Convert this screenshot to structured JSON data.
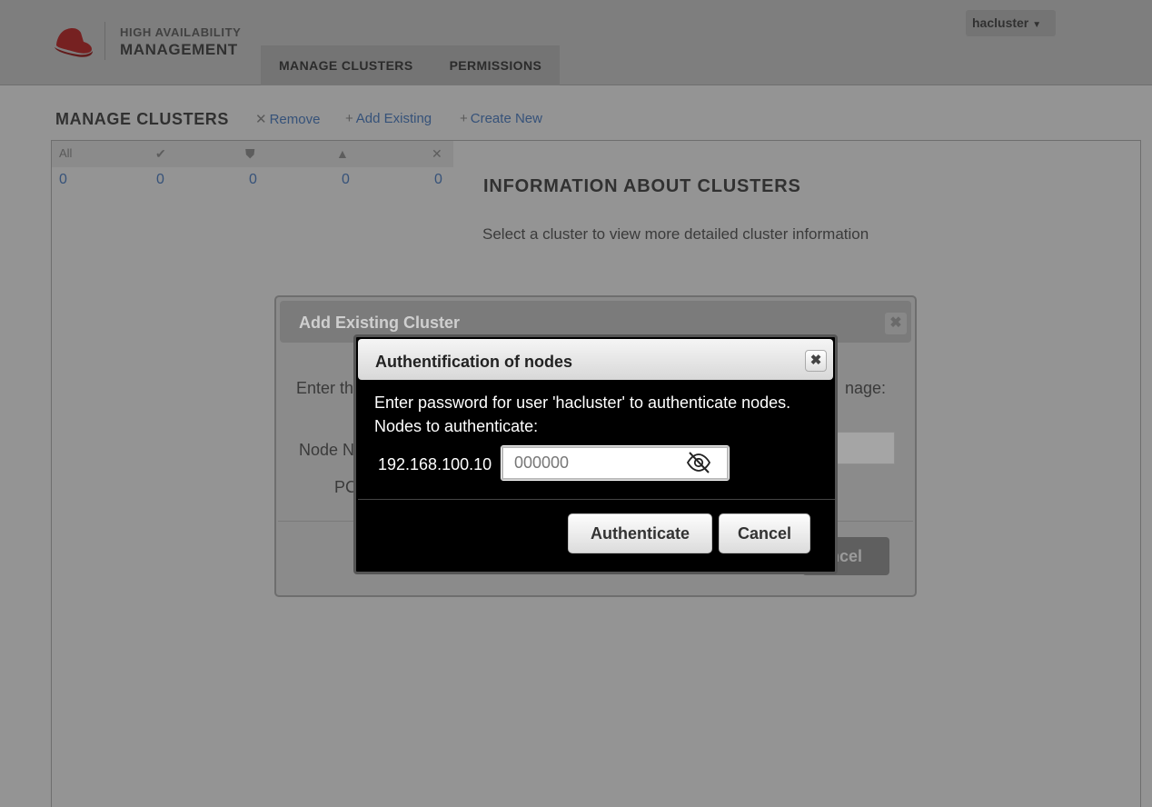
{
  "header": {
    "logo_line1": "HIGH AVAILABILITY",
    "logo_line2": "MANAGEMENT",
    "nav": [
      "MANAGE CLUSTERS",
      "PERMISSIONS"
    ],
    "user": "hacluster"
  },
  "toolbar": {
    "title": "MANAGE CLUSTERS",
    "remove": "Remove",
    "add_existing": "Add Existing",
    "create_new": "Create New"
  },
  "summary": {
    "all_label": "All",
    "counts": [
      "0",
      "0",
      "0",
      "0",
      "0"
    ],
    "icons": [
      "ok-check-icon",
      "shield-warning-icon",
      "warning-triangle-icon",
      "error-x-icon"
    ]
  },
  "info": {
    "title": "INFORMATION ABOUT CLUSTERS",
    "text": "Select a cluster to view more detailed cluster information"
  },
  "add_dialog": {
    "title": "Add Existing Cluster",
    "text_left": "Enter th",
    "text_right": "nage:",
    "label_node": "Node N",
    "label_port": "PC",
    "cancel_fragment": "ncel"
  },
  "auth_dialog": {
    "title": "Authentification of nodes",
    "line1": "Enter password for user 'hacluster' to authenticate nodes.",
    "line2": "Nodes to authenticate:",
    "node": "192.168.100.10",
    "password_placeholder": "000000",
    "authenticate_label": "Authenticate",
    "cancel_label": "Cancel"
  },
  "colors": {
    "link": "#5d8dd1",
    "logo_red": "#cc0000",
    "dialog_bg": "#000000"
  }
}
